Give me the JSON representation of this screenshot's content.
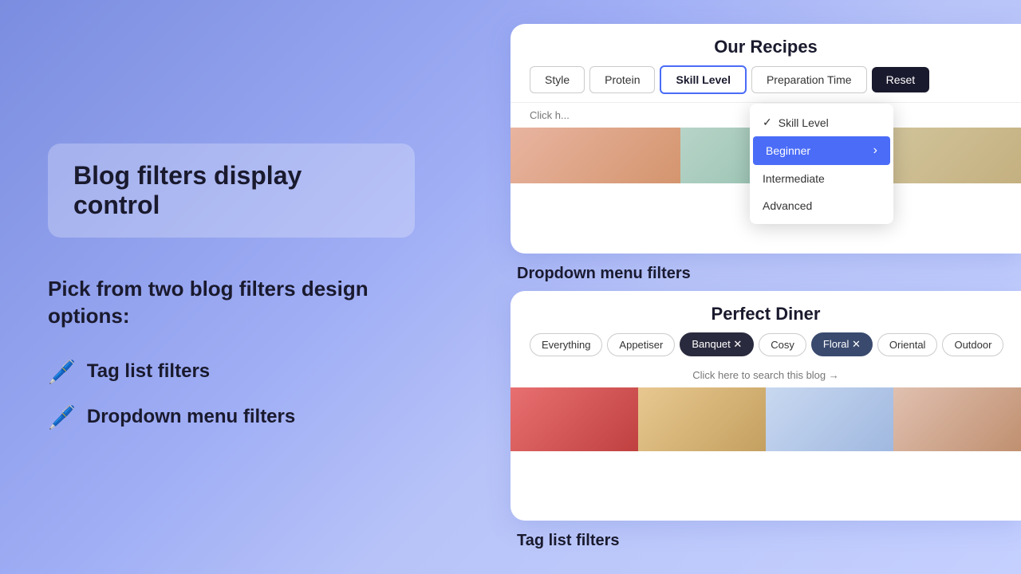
{
  "background": {
    "gradient": "linear-gradient(135deg, #7b8de0, #c5d0ff)"
  },
  "left": {
    "title": "Blog filters display control",
    "subtitle": "Pick from two blog filters design options:",
    "items": [
      {
        "emoji": "🖊️",
        "label": "Tag list filters"
      },
      {
        "emoji": "🖊️",
        "label": "Dropdown menu filters"
      }
    ]
  },
  "top_card": {
    "header": "Our Recipes",
    "filters": [
      "Style",
      "Protein",
      "Skill Level",
      "Preparation Time",
      "Reset"
    ],
    "click_hint": "Click h...",
    "dropdown": {
      "items": [
        {
          "label": "Skill Level",
          "state": "selected"
        },
        {
          "label": "Beginner",
          "state": "highlighted"
        },
        {
          "label": "Intermediate",
          "state": "normal"
        },
        {
          "label": "Advanced",
          "state": "normal"
        }
      ]
    },
    "label": "Dropdown menu filters"
  },
  "bottom_card": {
    "header": "Perfect Diner",
    "tags": [
      {
        "label": "Everything",
        "style": "normal"
      },
      {
        "label": "Appetiser",
        "style": "normal"
      },
      {
        "label": "Banquet ✕",
        "style": "dark"
      },
      {
        "label": "Cosy",
        "style": "normal"
      },
      {
        "label": "Floral ✕",
        "style": "dark-blue"
      },
      {
        "label": "Oriental",
        "style": "normal"
      },
      {
        "label": "Outdoor",
        "style": "normal"
      }
    ],
    "click_hint": "Click here to search this blog →",
    "label": "Tag list filters"
  }
}
